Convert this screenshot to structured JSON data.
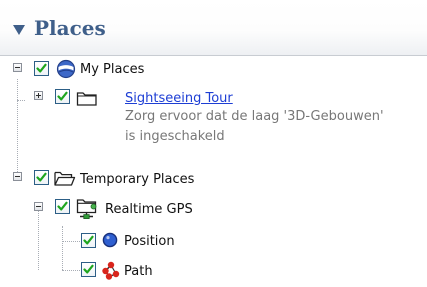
{
  "panel": {
    "title": "Places",
    "collapse_icon": "triangle-down-icon"
  },
  "tree": {
    "my_places": {
      "label": "My Places",
      "checked": true,
      "icon": "globe-icon",
      "expander": "minus"
    },
    "sightseeing_tour": {
      "label": "Sightseeing Tour",
      "description": "Zorg ervoor dat de laag '3D-Gebouwen' is ingeschakeld",
      "checked": true,
      "icon": "folder-icon",
      "expander": "plus"
    },
    "temporary_places": {
      "label": "Temporary Places",
      "checked": true,
      "icon": "open-folder-icon",
      "expander": "minus"
    },
    "realtime_gps": {
      "label": "Realtime GPS",
      "checked": true,
      "icon": "network-folder-icon",
      "expander": "minus"
    },
    "position": {
      "label": "Position",
      "checked": true,
      "icon": "blue-dot-icon"
    },
    "path": {
      "label": "Path",
      "checked": true,
      "icon": "red-path-icon"
    }
  },
  "colors": {
    "header_text": "#3f5f8a",
    "link": "#1d3ed4",
    "description": "#777777",
    "checkbox_border": "#2c5e86",
    "checkmark": "#1ea51e",
    "position_dot": "#2f5fd0",
    "path_nodes": "#d9251c"
  }
}
